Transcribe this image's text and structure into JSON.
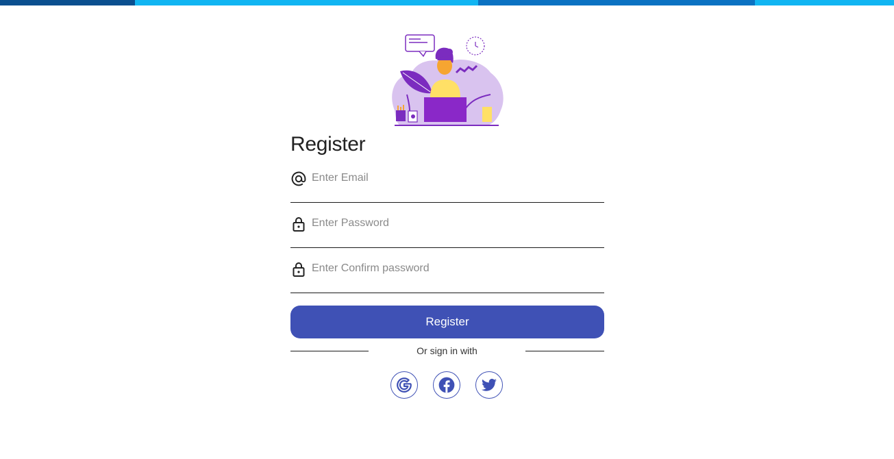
{
  "top_bar": {
    "segments": [
      {
        "color": "#0a4f8f"
      },
      {
        "color": "#11b5f2"
      },
      {
        "color": "#0b72c2"
      },
      {
        "color": "#11b5f2"
      }
    ]
  },
  "form": {
    "title": "Register",
    "email": {
      "placeholder": "Enter Email",
      "icon": "at-icon"
    },
    "password": {
      "placeholder": "Enter Password",
      "icon": "lock-icon"
    },
    "confirm_password": {
      "placeholder": "Enter Confirm password",
      "icon": "lock-icon"
    },
    "submit_label": "Register",
    "divider_text": "Or sign in with",
    "social": [
      {
        "name": "google",
        "icon": "google-icon"
      },
      {
        "name": "facebook",
        "icon": "facebook-icon"
      },
      {
        "name": "twitter",
        "icon": "twitter-icon"
      }
    ]
  },
  "colors": {
    "accent": "#3f51b5",
    "illustration_purple": "#7b2cbf",
    "illustration_light": "#d9c3ef"
  }
}
